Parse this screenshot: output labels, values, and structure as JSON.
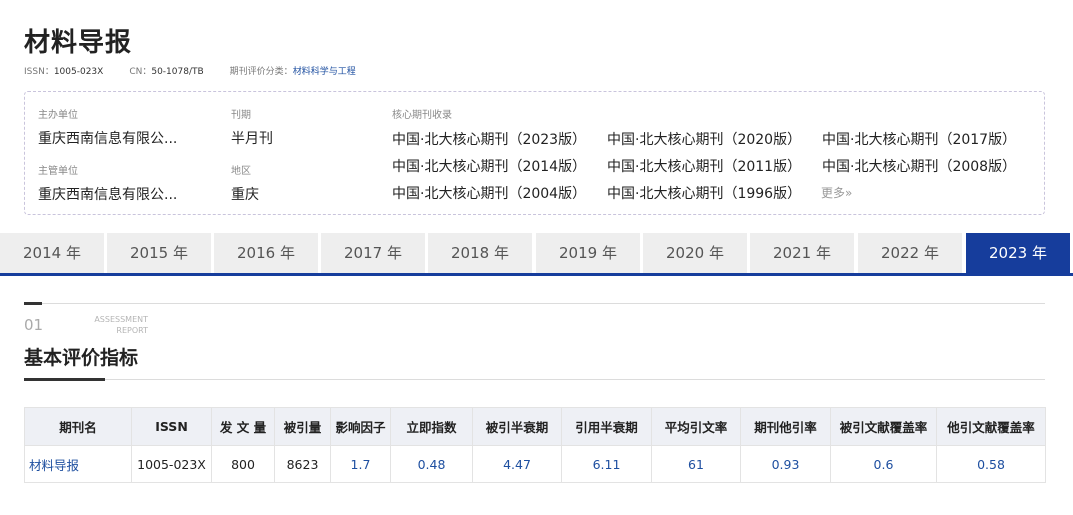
{
  "journal": {
    "title": "材料导报",
    "issn_label": "ISSN：",
    "issn": "1005-023X",
    "cn_label": "CN：",
    "cn": "50-1078/TB",
    "category_label": "期刊评价分类：",
    "category": "材料科学与工程"
  },
  "info": {
    "sponsor_label": "主办单位",
    "sponsor": "重庆西南信息有限公...",
    "supervisor_label": "主管单位",
    "supervisor": "重庆西南信息有限公...",
    "period_label": "刊期",
    "period": "半月刊",
    "region_label": "地区",
    "region": "重庆",
    "core_label": "核心期刊收录",
    "core_items": [
      "中国·北大核心期刊（2023版）",
      "中国·北大核心期刊（2020版）",
      "中国·北大核心期刊（2017版）",
      "中国·北大核心期刊（2014版）",
      "中国·北大核心期刊（2011版）",
      "中国·北大核心期刊（2008版）",
      "中国·北大核心期刊（2004版）",
      "中国·北大核心期刊（1996版）"
    ],
    "more": "更多»"
  },
  "years": [
    "2014 年",
    "2015 年",
    "2016 年",
    "2017 年",
    "2018 年",
    "2019 年",
    "2020 年",
    "2021 年",
    "2022 年",
    "2023 年"
  ],
  "active_year_index": 9,
  "section": {
    "number": "01",
    "eng_line1": "ASSESSMENT",
    "eng_line2": "REPORT",
    "title": "基本评价指标"
  },
  "table": {
    "headers": [
      "期刊名",
      "ISSN",
      "发 文 量",
      "被引量",
      "影响因子",
      "立即指数",
      "被引半衰期",
      "引用半衰期",
      "平均引文率",
      "期刊他引率",
      "被引文献覆盖率",
      "他引文献覆盖率"
    ],
    "row": [
      "材料导报",
      "1005-023X",
      "800",
      "8623",
      "1.7",
      "0.48",
      "4.47",
      "6.11",
      "61",
      "0.93",
      "0.6",
      "0.58"
    ]
  },
  "colors": {
    "accent": "#163d9c",
    "link": "#1e4fa0"
  }
}
